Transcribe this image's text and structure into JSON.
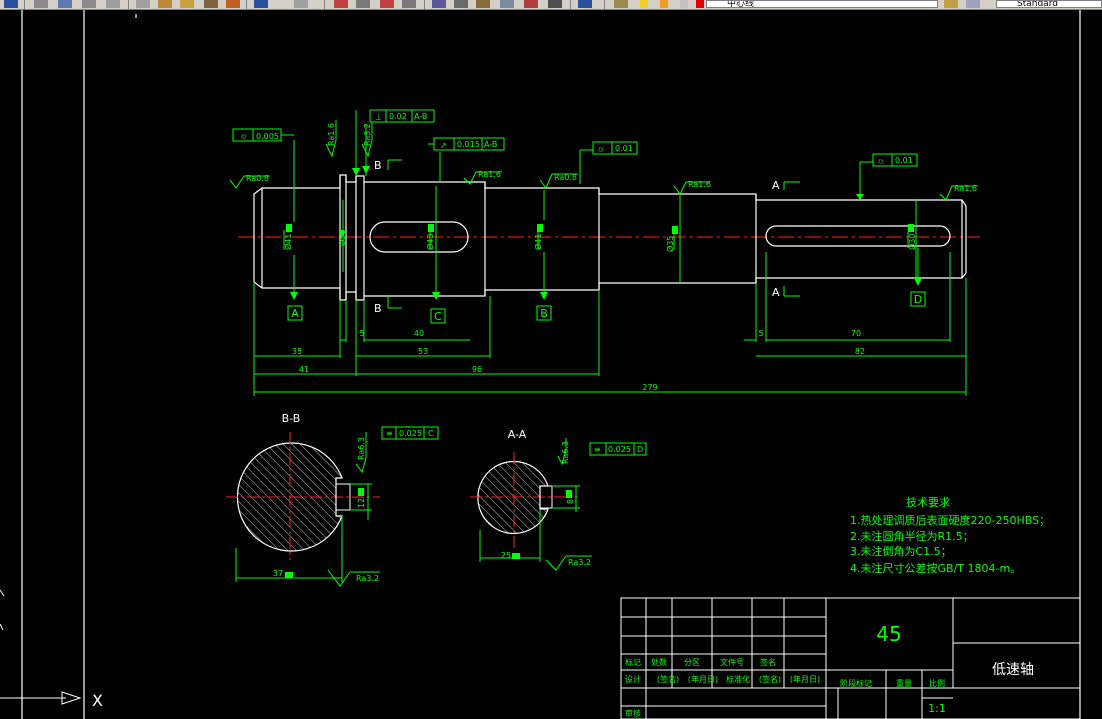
{
  "toolbar": {
    "layer_value": "中心线",
    "text_style_value": "Standard"
  },
  "colors": {
    "background": "#000000",
    "geometry": "#ffffff",
    "dimension": "#00ff00",
    "centerline": "#ff0000",
    "toolbar": "#d4d0c8"
  },
  "drawing": {
    "datums": {
      "a": "A",
      "b": "B",
      "c": "C",
      "d": "D"
    },
    "section_labels": {
      "b_b": "B-B",
      "a_a": "A-A"
    },
    "tolerance_frames": {
      "f1_value": "0.005",
      "f2_value": "0.02",
      "f2_datum": "A-B",
      "f3_value": "0.015",
      "f3_datum": "A-B",
      "f4_value": "0.01",
      "f5_value": "0.01",
      "f6_value": "0.025",
      "f6_datum": "C",
      "f7_value": "0.025",
      "f7_datum": "D"
    },
    "roughness": {
      "r1": "Ra0.8",
      "r2": "Ra1.6",
      "r3": "Ra3.2",
      "r4": "Ra1.6",
      "r5": "Ra0.8",
      "r6": "Ra1.6",
      "r7": "Ra1.6",
      "r8": "Ra6.3",
      "r9": "Ra3.2",
      "r10": "Ra6.3",
      "r11": "Ra3.2"
    },
    "diameters": {
      "d1": "Ø41",
      "d2": "Ø51",
      "d3": "Ø43",
      "d4": "Ø41",
      "d5": "Ø35",
      "d6": "Ø30"
    },
    "dimensions": {
      "d35": "35",
      "d41": "41",
      "d5a": "5",
      "d40": "40",
      "d53": "53",
      "d96": "96",
      "d279": "279",
      "d5b": "5",
      "d70": "70",
      "d82": "82",
      "d37": "37",
      "d12": "12",
      "d25": "25",
      "d8": "8"
    },
    "notes": {
      "title": "技术要求",
      "n1": "1.热处理调质后表面硬度220-250HBS；",
      "n2": "2.未注圆角半径为R1.5；",
      "n3": "3.未注倒角为C1.5；",
      "n4": "4.未注尺寸公差按GB/T 1804-m。"
    },
    "title_block": {
      "material": "45",
      "part_name": "低速轴",
      "col_mark": "标记",
      "col_count": "处数",
      "col_zone": "分区",
      "col_docno": "文件号",
      "col_sign": "签名",
      "design": "设计",
      "sign1": "(签名)",
      "date1": "(年月日)",
      "standardization": "标准化",
      "sign2": "(签名)",
      "date2": "(年月日)",
      "stage_mark": "阶段标记",
      "weight": "重量",
      "scale_label": "比例",
      "scale": "1:1",
      "review": "审核"
    },
    "ucs": {
      "x_label": "X"
    }
  }
}
